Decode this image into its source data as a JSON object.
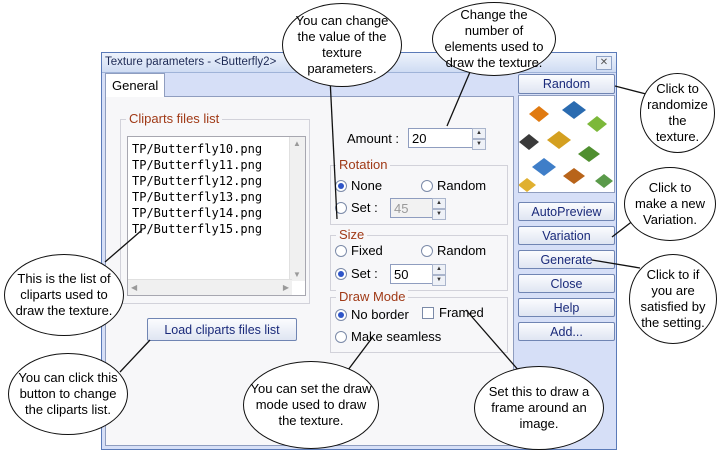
{
  "window": {
    "title": "Texture parameters - <Butterfly2>",
    "close_glyph": "✕",
    "tab_general": "General"
  },
  "cliparts": {
    "group_label": "Cliparts files list",
    "files": [
      "TP/Butterfly10.png",
      "TP/Butterfly11.png",
      "TP/Butterfly12.png",
      "TP/Butterfly13.png",
      "TP/Butterfly14.png",
      "TP/Butterfly15.png"
    ],
    "load_button": "Load cliparts files list"
  },
  "amount": {
    "label": "Amount :",
    "value": "20"
  },
  "rotation": {
    "group_label": "Rotation",
    "none": "None",
    "random": "Random",
    "set": "Set :",
    "set_value": "45",
    "selected": "None"
  },
  "size": {
    "group_label": "Size",
    "fixed": "Fixed",
    "random": "Random",
    "set": "Set :",
    "set_value": "50",
    "selected": "Set"
  },
  "draw_mode": {
    "group_label": "Draw Mode",
    "no_border": "No border",
    "framed": "Framed",
    "make_seamless": "Make seamless",
    "selected": "No border",
    "framed_checked": false
  },
  "buttons": {
    "random": "Random",
    "autopreview": "AutoPreview",
    "variation": "Variation",
    "generate": "Generate",
    "close": "Close",
    "help": "Help",
    "add": "Add..."
  },
  "callouts": {
    "change_value": "You can change the value of the texture parameters.",
    "change_number": "Change the number of elements used to draw the texture.",
    "randomize": "Click to randomize the texture.",
    "variation": "Click to make a new Variation.",
    "generate": "Click to if you are satisfied by the setting.",
    "list": "This is the list of cliparts used to draw the texture.",
    "load": "You can click this button to change the cliparts list.",
    "draw_mode": "You can set the draw mode used to draw the texture.",
    "frame": "Set this to draw a frame around an image."
  },
  "colors": {
    "group_label": "#a03a17",
    "button_text": "#1a2a7a",
    "window_bg": "#d6dff7"
  }
}
